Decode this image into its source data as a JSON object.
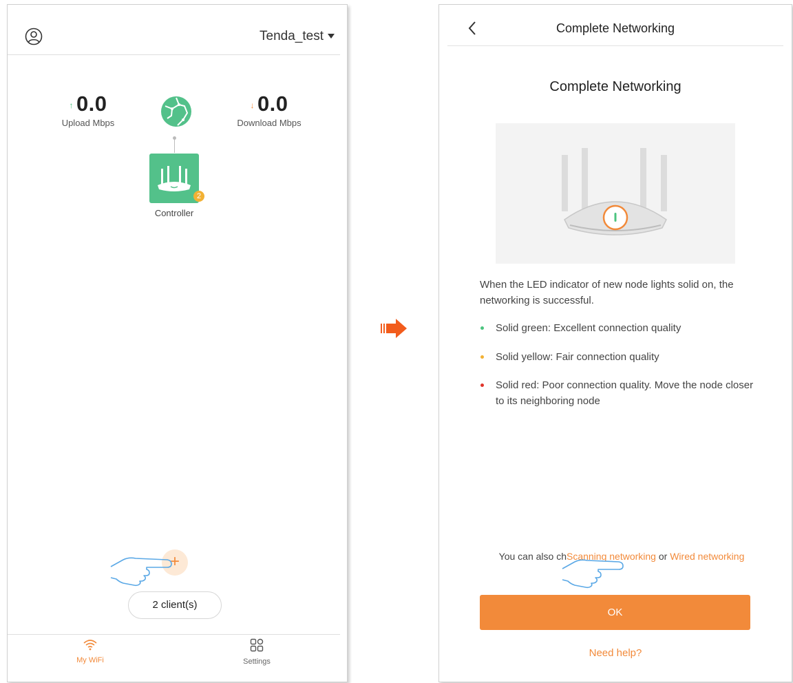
{
  "left_screen": {
    "network_name": "Tenda_test",
    "upload": {
      "value": "0.0",
      "label": "Upload Mbps",
      "arrow": "↑"
    },
    "download": {
      "value": "0.0",
      "label": "Download Mbps",
      "arrow": "↓"
    },
    "controller": {
      "label": "Controller",
      "badge": "2"
    },
    "clients_button": "2 client(s)",
    "add_button": "+",
    "tabs": [
      {
        "label": "My WiFi",
        "icon": "wifi-icon",
        "active": true
      },
      {
        "label": "Settings",
        "icon": "grid-icon",
        "active": false
      }
    ]
  },
  "right_screen": {
    "header_title": "Complete Networking",
    "page_title": "Complete Networking",
    "description": "When the LED indicator of new node lights solid on, the networking is successful.",
    "bullets": [
      {
        "text": "Solid green: Excellent connection quality",
        "color": "#4cc47f"
      },
      {
        "text": "Solid yellow: Fair connection quality",
        "color": "#f2b134"
      },
      {
        "text": "Solid red: Poor connection quality. Move the node closer to its neighboring node",
        "color": "#e0352b"
      }
    ],
    "alternative": {
      "prefix": "You can also ch",
      "link1": "Scanning networking",
      "middle": " or ",
      "link2": "Wired networking"
    },
    "ok_button": "OK",
    "help_link": "Need help?"
  },
  "colors": {
    "accent": "#f28a3a",
    "green": "#53c18a",
    "badge": "#f2b134"
  }
}
